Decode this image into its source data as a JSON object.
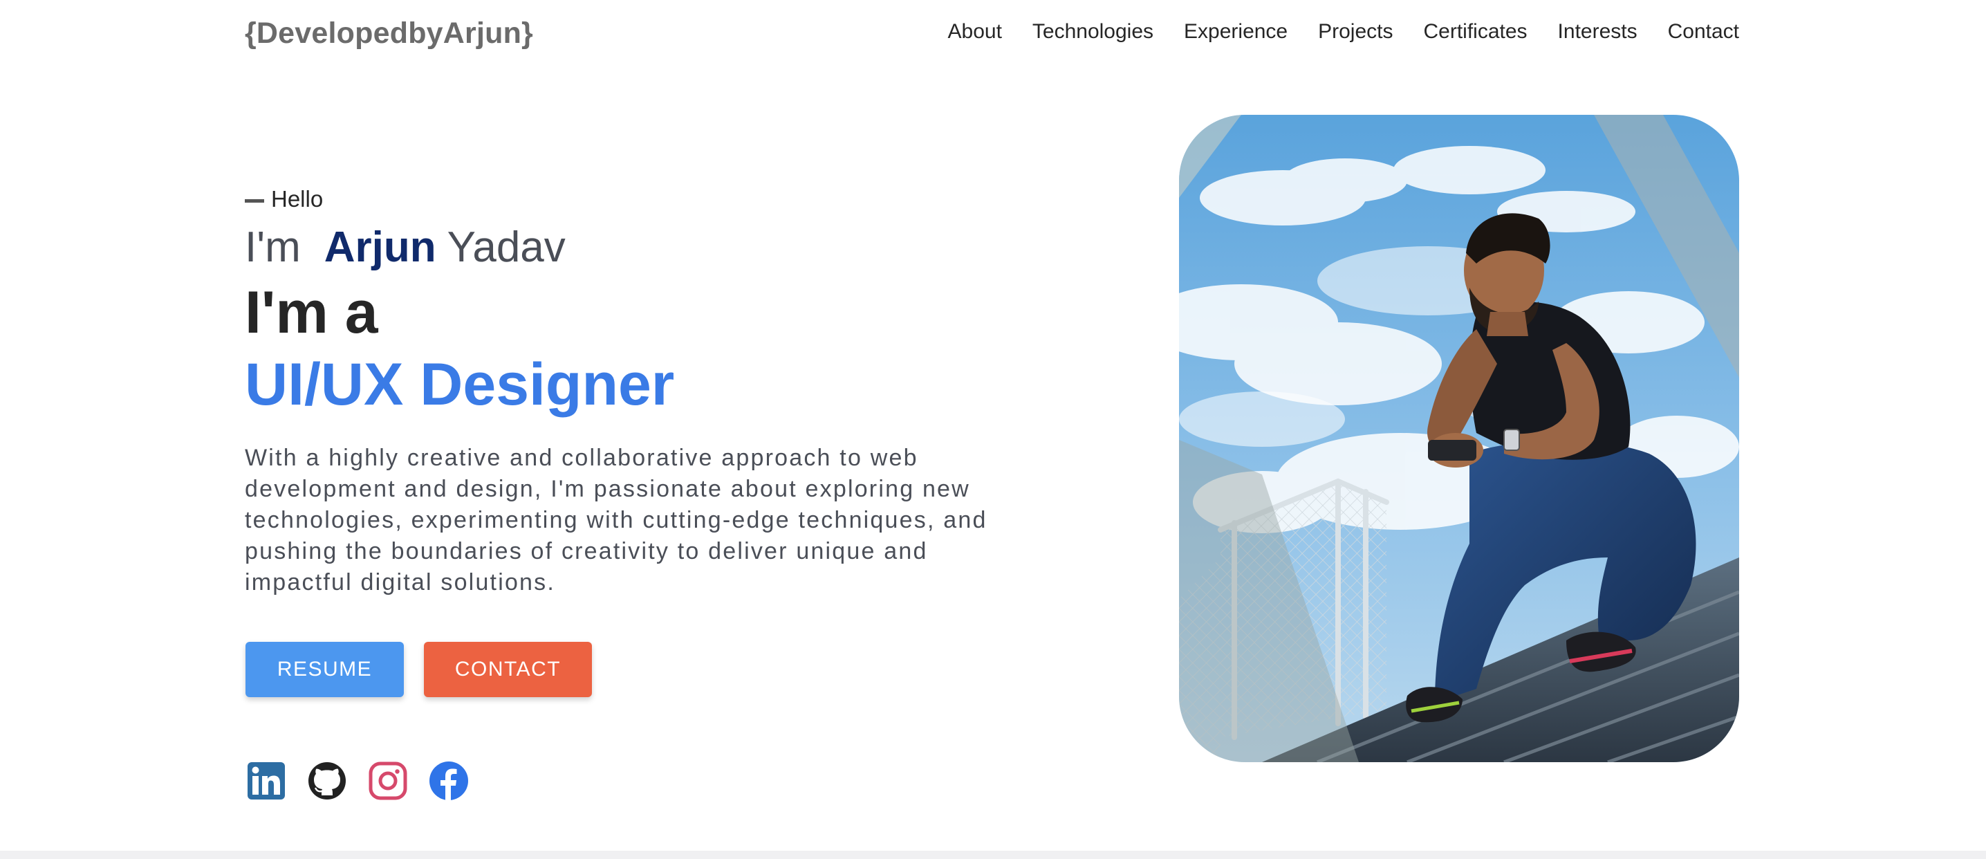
{
  "brand": "{DevelopedbyArjun}",
  "nav": {
    "items": [
      "About",
      "Technologies",
      "Experience",
      "Projects",
      "Certificates",
      "Interests",
      "Contact"
    ]
  },
  "hero": {
    "greeting": "Hello",
    "name_prefix": "I'm",
    "first_name": "Arjun",
    "last_name": "Yadav",
    "role_prefix": "I'm a",
    "role": "UI/UX Designer",
    "description": "With a highly creative and collaborative approach to web development and design, I'm passionate about exploring new technologies, experimenting with cutting-edge techniques, and pushing the boundaries of creativity to deliver unique and impactful digital solutions.",
    "buttons": {
      "resume": "RESUME",
      "contact": "CONTACT"
    }
  },
  "socials": [
    {
      "icon": "linkedin-icon",
      "color": "#2d6da3"
    },
    {
      "icon": "github-icon",
      "color": "#222222"
    },
    {
      "icon": "instagram-icon",
      "color": "#d6496b"
    },
    {
      "icon": "facebook-icon",
      "color": "#2f74e8"
    }
  ],
  "colors": {
    "accent_blue": "#3a7be6",
    "name_navy": "#102a6b",
    "resume_button": "#4c97ef",
    "contact_button": "#ec6241",
    "brand_gray": "#6b6b6b"
  },
  "portrait": {
    "subject": "man in dark polo and jeans seated on stadium bleachers under blue sky"
  }
}
